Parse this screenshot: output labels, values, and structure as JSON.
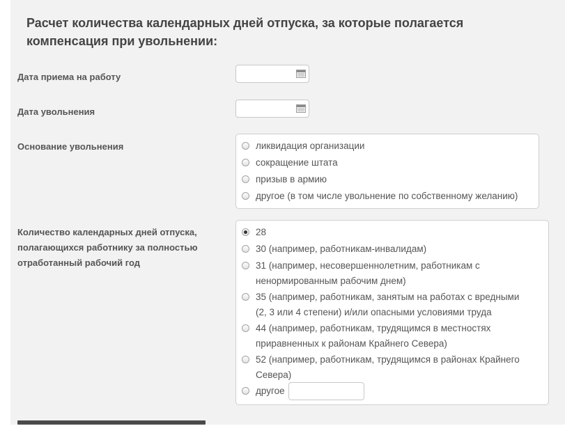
{
  "form": {
    "title": "Расчет количества календарных дней отпуска, за которые полагается компенсация при увольнении:",
    "hire_date": {
      "label": "Дата приема на работу",
      "value": ""
    },
    "dismissal_date": {
      "label": "Дата увольнения",
      "value": ""
    },
    "dismissal_reason": {
      "label": "Основание увольнения",
      "options": [
        "ликвидация организации",
        "сокращение штата",
        "призыв в армию",
        "другое (в том числе увольнение по собственному желанию)"
      ]
    },
    "vacation_days": {
      "label": "Количество календарных дней отпуска, полагающихся работнику за полностью отработанный рабочий год",
      "selected": "28",
      "options": [
        {
          "line1": "28"
        },
        {
          "line1": "30 (например, работникам-инвалидам)"
        },
        {
          "line1": "31 (например, несовершеннолетним, работникам с",
          "line2": "ненормированным рабочим днем)"
        },
        {
          "line1": "35 (например, работникам, занятым на работах с вредными",
          "line2": "(2, 3 или 4 степени) и/или опасными условиями труда"
        },
        {
          "line1": "44 (например, работникам, трудящимся в местностях",
          "line2": "приравненных к районам Крайнего Севера)"
        },
        {
          "line1": "52 (например, работникам, трудящимся в районах Крайнего",
          "line2": "Севера)"
        },
        {
          "line1": "другое",
          "input_value": ""
        }
      ]
    }
  }
}
